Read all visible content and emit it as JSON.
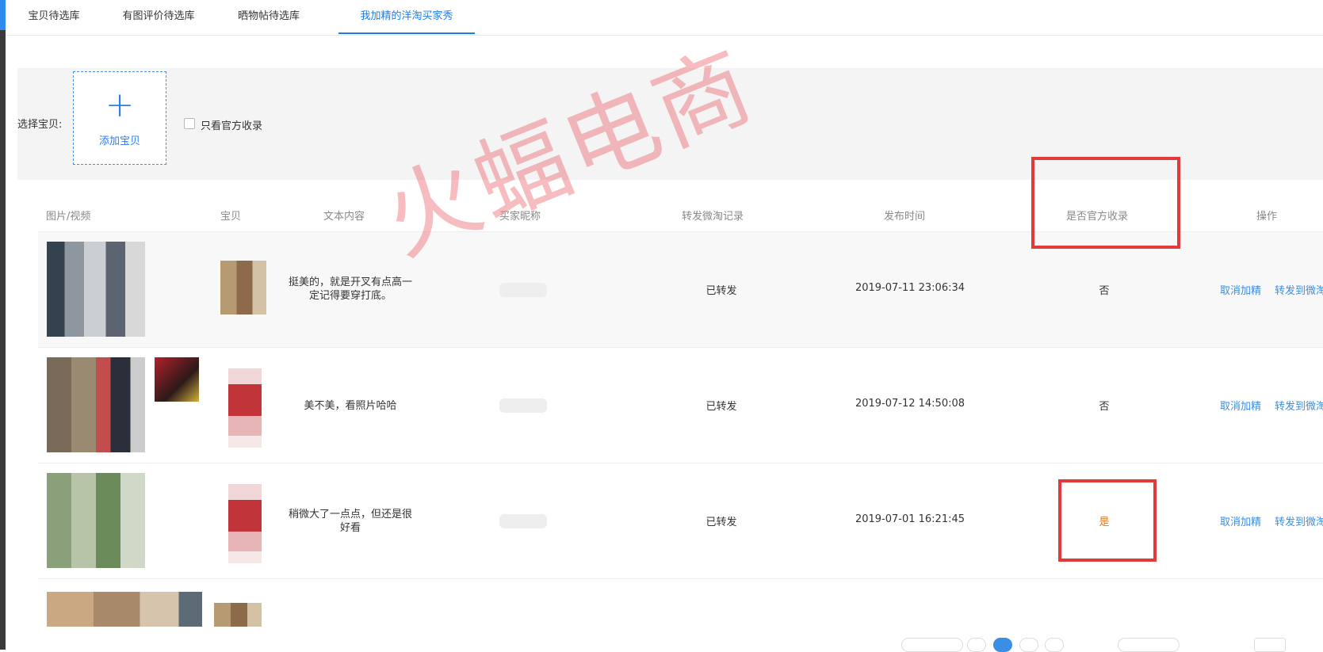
{
  "tabs": [
    {
      "label": "宝贝待选库"
    },
    {
      "label": "有图评价待选库"
    },
    {
      "label": "晒物帖待选库"
    },
    {
      "label": "我加精的洋淘买家秀"
    }
  ],
  "filter": {
    "select_label": "选择宝贝:",
    "add_button_label": "添加宝贝",
    "official_only_label": "只看官方收录"
  },
  "table": {
    "columns": [
      "图片/视频",
      "宝贝",
      "文本内容",
      "买家昵称",
      "转发微淘记录",
      "发布时间",
      "是否官方收录",
      "操作"
    ],
    "rows": [
      {
        "text_line1": "挺美的，就是开叉有点高一",
        "text_line2": "定记得要穿打底。",
        "forward": "已转发",
        "time": "2019-07-11 23:06:34",
        "official": "否"
      },
      {
        "text_line1": "美不美，看照片哈哈",
        "text_line2": "",
        "forward": "已转发",
        "time": "2019-07-12 14:50:08",
        "official": "否"
      },
      {
        "text_line1": "稍微大了一点点，但还是很",
        "text_line2": "好看",
        "forward": "已转发",
        "time": "2019-07-01 16:21:45",
        "official": "是"
      }
    ],
    "actions": {
      "cancel": "取消加精",
      "forward": "转发到微淘"
    }
  },
  "watermark": "火蝠电商",
  "colors": {
    "accent": "#1f7ee8",
    "link": "#3a8ee6",
    "highlight_box": "#e23a3a",
    "official_yes": "#e0771e"
  }
}
